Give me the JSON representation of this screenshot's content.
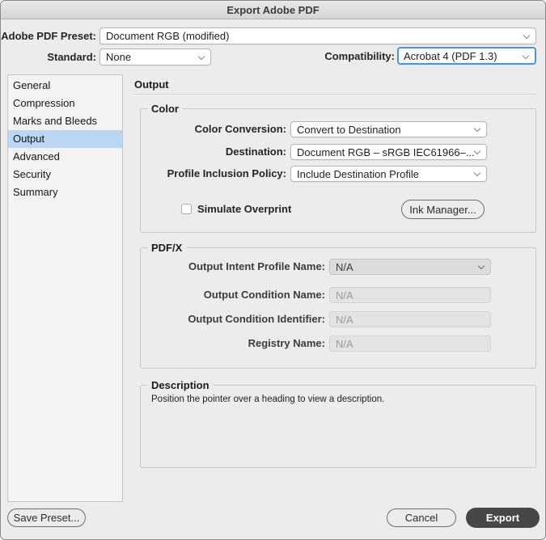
{
  "window": {
    "title": "Export Adobe PDF"
  },
  "header": {
    "preset_label": "Adobe PDF Preset:",
    "preset_value": "Document RGB (modified)",
    "standard_label": "Standard:",
    "standard_value": "None",
    "compatibility_label": "Compatibility:",
    "compatibility_value": "Acrobat 4 (PDF 1.3)"
  },
  "sidebar": {
    "items": [
      {
        "label": "General"
      },
      {
        "label": "Compression"
      },
      {
        "label": "Marks and Bleeds"
      },
      {
        "label": "Output"
      },
      {
        "label": "Advanced"
      },
      {
        "label": "Security"
      },
      {
        "label": "Summary"
      }
    ],
    "selected_item": "Output"
  },
  "main": {
    "heading": "Output",
    "color_section": {
      "legend": "Color",
      "color_conversion_label": "Color Conversion:",
      "color_conversion_value": "Convert to Destination",
      "destination_label": "Destination:",
      "destination_value": "Document RGB – sRGB IEC61966–...",
      "profile_policy_label": "Profile Inclusion Policy:",
      "profile_policy_value": "Include Destination Profile",
      "simulate_overprint_label": "Simulate Overprint",
      "simulate_overprint_checked": false,
      "ink_manager_label": "Ink Manager..."
    },
    "pdfx_section": {
      "legend": "PDF/X",
      "intent_label": "Output Intent Profile Name:",
      "intent_value": "N/A",
      "condition_name_label": "Output Condition Name:",
      "condition_name_value": "N/A",
      "condition_id_label": "Output Condition Identifier:",
      "condition_id_value": "N/A",
      "registry_label": "Registry Name:",
      "registry_value": "N/A"
    },
    "description_section": {
      "legend": "Description",
      "text": "Position the pointer over a heading to view a description."
    }
  },
  "footer": {
    "save_preset_label": "Save Preset...",
    "cancel_label": "Cancel",
    "export_label": "Export"
  },
  "icons": {
    "chevron_down": "v-chevron"
  },
  "colors": {
    "dialog_background": "#ececec",
    "focus_ring": "#4a96d9",
    "sidebar_selected": "#b9d6f2",
    "export_button": "#474747",
    "disabled_field": "#e3e3e3",
    "disabled_dropdown": "#dcdcdc"
  }
}
